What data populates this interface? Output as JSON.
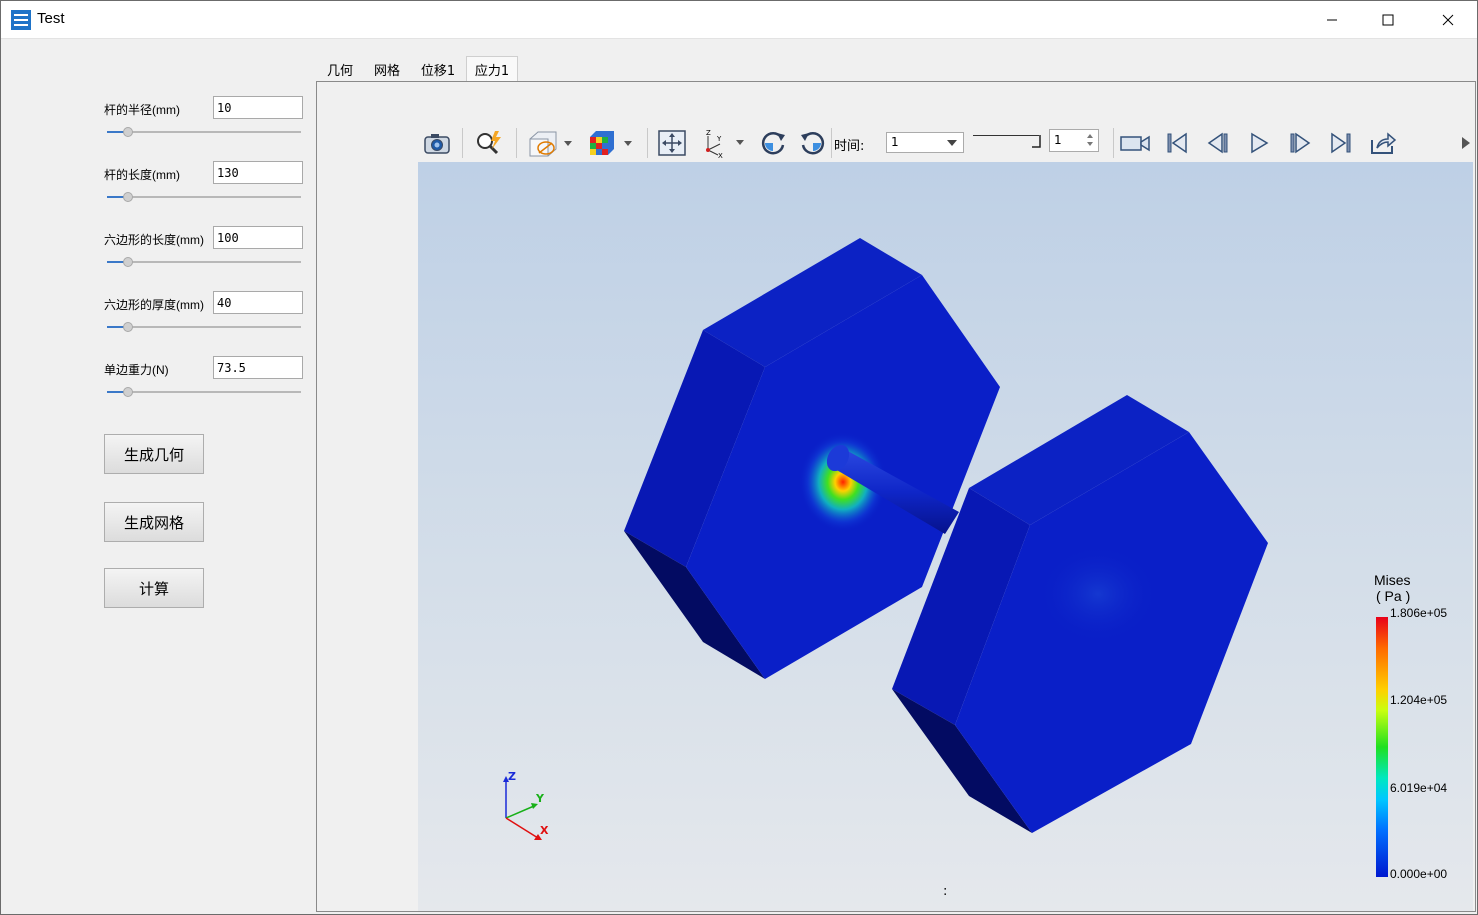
{
  "window": {
    "title": "Test"
  },
  "params": [
    {
      "label": "杆的半径(mm)",
      "value": "10",
      "slider": 0.09
    },
    {
      "label": "杆的长度(mm)",
      "value": "130",
      "slider": 0.09
    },
    {
      "label": "六边形的长度(mm)",
      "value": "100",
      "slider": 0.09
    },
    {
      "label": "六边形的厚度(mm)",
      "value": "40",
      "slider": 0.09
    },
    {
      "label": "单边重力(N)",
      "value": "73.5",
      "slider": 0.09
    }
  ],
  "buttons": {
    "geometry": "生成几何",
    "mesh": "生成网格",
    "compute": "计算"
  },
  "tabs": [
    "几何",
    "网格",
    "位移1",
    "应力1"
  ],
  "toolbar": {
    "time_label": "时间:",
    "time_value": "1",
    "frame_value": "1"
  },
  "legend": {
    "title_line1": "Mises",
    "title_line2": "( Pa )",
    "ticks": [
      "1.806e+05",
      "1.204e+05",
      "6.019e+04",
      "0.000e+00"
    ]
  },
  "axes": {
    "x": "X",
    "y": "Y",
    "z": "Z"
  },
  "status_char": ":",
  "colors": {
    "part": "#0a1fc8",
    "accent": "#3a78c8"
  }
}
